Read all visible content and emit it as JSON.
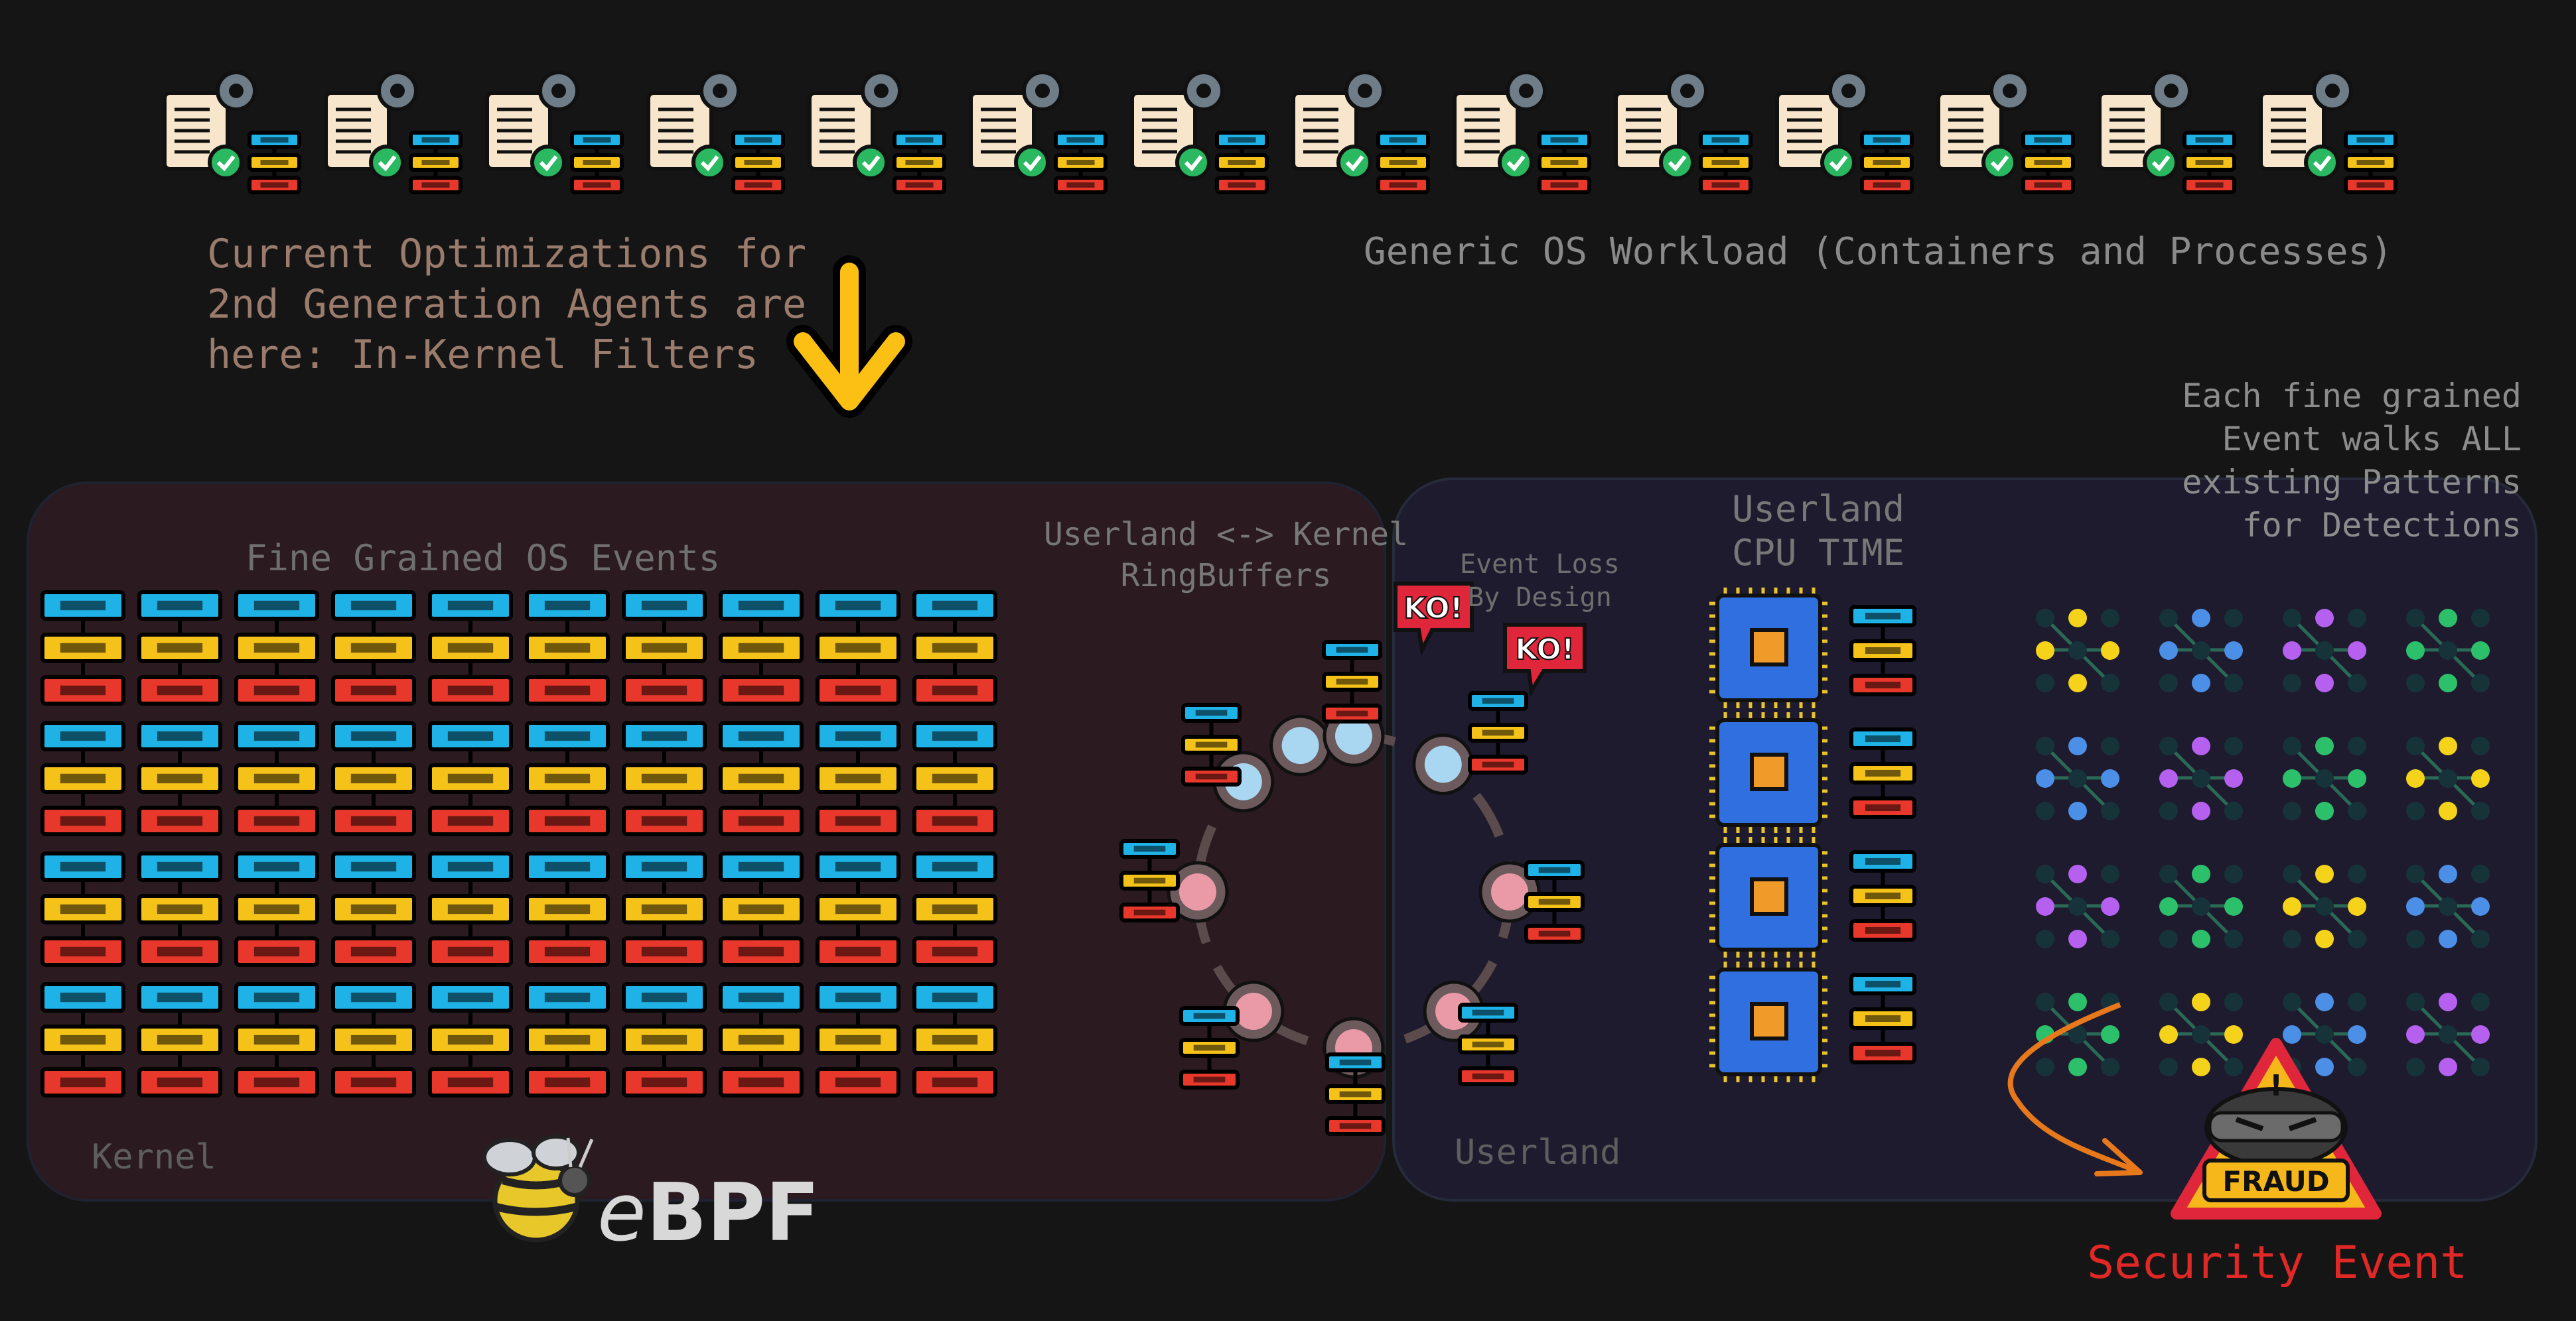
{
  "annotations": {
    "agents_note": "Current Optimizations for\n2nd Generation Agents are\nhere: In-Kernel Filters",
    "workload": "Generic OS Workload (Containers and Processes)",
    "patterns_note": "Each fine grained\nEvent walks ALL\nexisting Patterns\nfor Detections",
    "fine_grained": "Fine Grained OS Events",
    "ringbuffers": "Userland <-> Kernel\nRingBuffers",
    "event_loss": "Event Loss\nBy Design",
    "cpu_time": "Userland\nCPU TIME",
    "kernel": "Kernel",
    "userland": "Userland",
    "security_event": "Security Event"
  },
  "badges": {
    "ko": "KO!",
    "fraud": "FRAUD"
  },
  "logo": {
    "prefix": "e",
    "name": "BPF"
  },
  "colors": {
    "background": "#151515",
    "kernel_panel": "#2b1a1f",
    "userland_panel": "#1e1b2f",
    "event_blue": "#1fb2e6",
    "event_yellow": "#f5c21a",
    "event_red": "#e8372b",
    "arrow_yellow": "#fcbf14",
    "security_red": "#e02826"
  },
  "icons": {
    "workload": "config-document-icon",
    "cpu": "cpu-chip-icon",
    "pattern": "detection-pattern-icon",
    "fraud": "fraud-warning-icon",
    "ko": "ko-burst-icon",
    "bee": "bee-icon"
  }
}
